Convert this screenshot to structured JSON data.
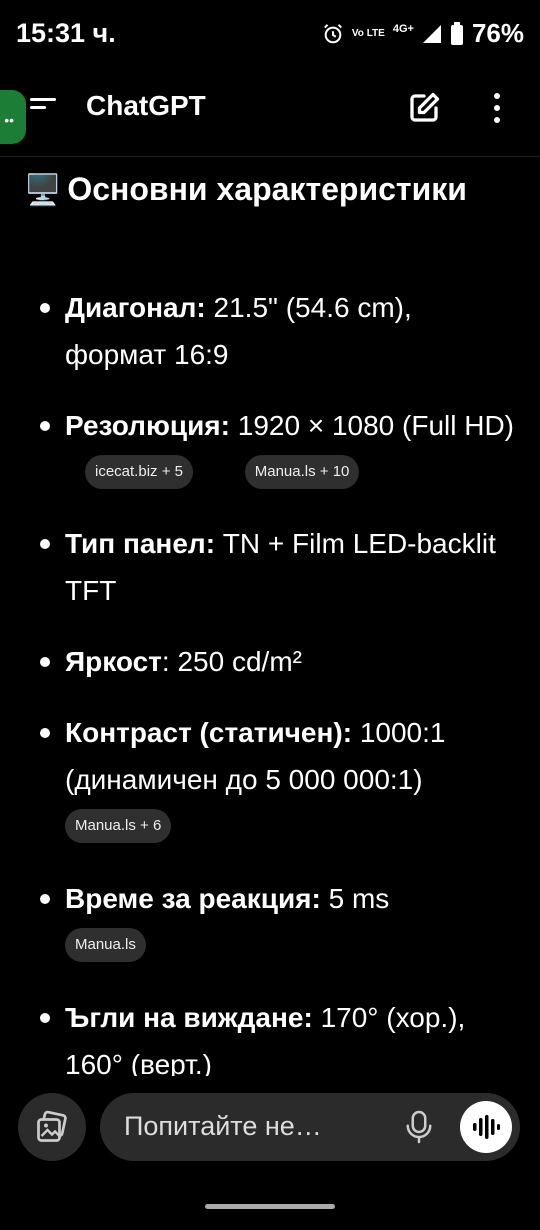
{
  "status_bar": {
    "time": "15:31 ч.",
    "volte": "Vo LTE",
    "network": "4G+",
    "battery": "76%"
  },
  "app_bar": {
    "title": "ChatGPT"
  },
  "content": {
    "heading_icon": "🖥️",
    "heading": "Основни характеристики",
    "specs": [
      {
        "label": "Диагонал:",
        "text": " 21.5\" (54.6 cm), формат 16:9",
        "chips": []
      },
      {
        "label": "Резолюция:",
        "text": " 1920 × 1080 (Full HD)",
        "chips": [
          "icecat.biz + 5",
          "Manua.ls + 10"
        ]
      },
      {
        "label": "Тип панел:",
        "text": " TN + Film LED-backlit TFT",
        "chips": []
      },
      {
        "label": "Яркост",
        "text": ": 250 cd/m²",
        "chips": []
      },
      {
        "label": "Контраст (статичен):",
        "text": " 1000:1 (динамичен до 5 000 000:1)",
        "chips": [
          "Manua.ls + 6"
        ]
      },
      {
        "label": "Време за реакция:",
        "text": " 5 ms",
        "chips": [
          "Manua.ls"
        ]
      },
      {
        "label": "Ъгли на виждане:",
        "text": " 170° (хор.), 160° (верт.)",
        "chips": []
      }
    ]
  },
  "composer": {
    "placeholder": "Попитайте не…"
  },
  "icons": {
    "menu": "menu-icon",
    "edit": "edit-icon",
    "more": "more-vertical-icon",
    "attach": "image-gallery-icon",
    "mic": "mic-icon",
    "voice": "voice-wave-icon"
  }
}
